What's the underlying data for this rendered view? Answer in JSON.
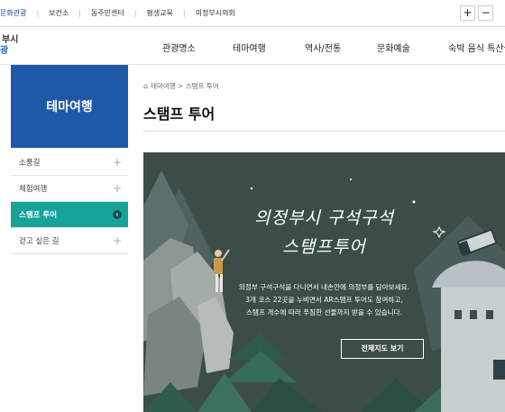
{
  "top_links": [
    "문화관광",
    "보건소",
    "동주민센터",
    "평생교육",
    "의정부시의회"
  ],
  "zoom": {
    "plus": "+",
    "minus": "−"
  },
  "logo": {
    "line1": "부시",
    "line2": "광"
  },
  "gnb": [
    "관광명소",
    "테마여행",
    "역사/전통",
    "문화예술",
    "숙박 음식 특산물"
  ],
  "sidebar": {
    "title": "테마여행",
    "items": [
      {
        "label": "소풍길",
        "active": false
      },
      {
        "label": "체험여행",
        "active": false
      },
      {
        "label": "스탬프 투어",
        "active": true
      },
      {
        "label": "걷고 싶은 길",
        "active": false
      }
    ]
  },
  "breadcrumb": {
    "home_icon": "home-icon",
    "text": "테마여행 > 스탬프 투어"
  },
  "page_title": "스탬프 투어",
  "banner": {
    "title_line1": "의정부시 구석구석",
    "title_line2": "스탬프투어",
    "desc": [
      "의정부 구석구석을 다니면서 내손안에 의정부를 담아보세요.",
      "3개 코스 22곳을 누비면서 AR스탬프 투어도 참여하고,",
      "스탬프 개수에 따라 푸짐한 선물까지 받을 수 있습니다."
    ],
    "button": "전체지도 보기"
  },
  "colors": {
    "sidebar_head": "#1e59a8",
    "active_item": "#16a39a",
    "banner_bg": "#3c4d48",
    "logo_accent": "#1c6bd0"
  }
}
